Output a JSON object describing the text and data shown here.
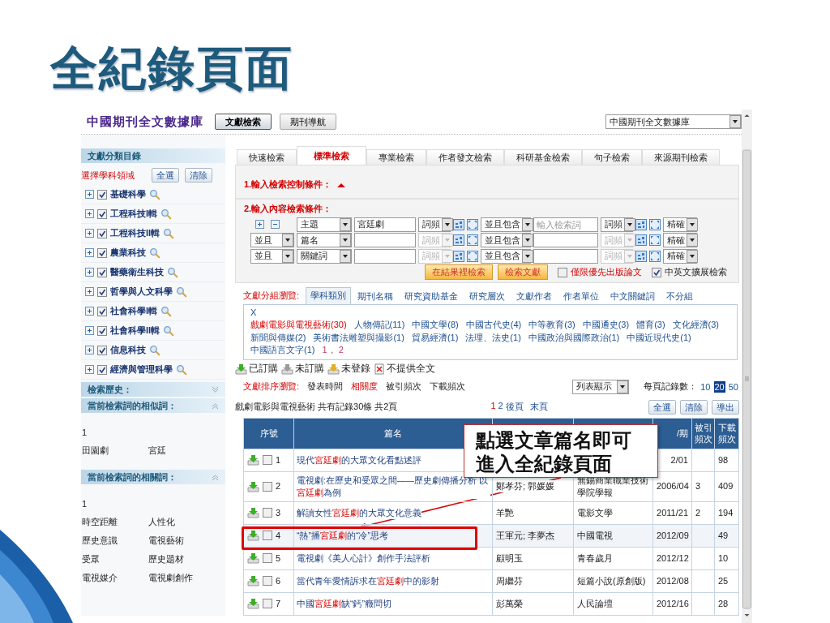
{
  "slide_title": "全紀錄頁面",
  "header": {
    "logo": "中國期刊全文數據庫",
    "tabs": [
      {
        "label": "文獻檢索",
        "selected": true
      },
      {
        "label": "期刊導航",
        "selected": false
      }
    ],
    "database_select": "中國期刊全文數據庫"
  },
  "sidebar": {
    "title": "文獻分類目錄",
    "subject_label": "選擇學科領域",
    "buttons": [
      "全選",
      "清除"
    ],
    "categories": [
      {
        "label": "基礎科學",
        "checked": true
      },
      {
        "label": "工程科技I輯",
        "checked": true
      },
      {
        "label": "工程科技II輯",
        "checked": true
      },
      {
        "label": "農業科技",
        "checked": true
      },
      {
        "label": "醫藥衛生科技",
        "checked": true
      },
      {
        "label": "哲學與人文科學",
        "checked": true
      },
      {
        "label": "社會科學I輯",
        "checked": true
      },
      {
        "label": "社會科學II輯",
        "checked": true
      },
      {
        "label": "信息科技",
        "checked": true
      },
      {
        "label": "經濟與管理科學",
        "checked": true
      }
    ],
    "history_title": "檢索歷史：",
    "similar_title": "當前檢索詞的相似詞：",
    "similar_page": "1",
    "similar_terms": [
      "田園劇",
      "宮廷"
    ],
    "related_title": "當前檢索詞的相關詞：",
    "related_page": "1",
    "related_terms": [
      "時空距離",
      "人性化",
      "歷史意識",
      "電視藝術",
      "受眾",
      "歷史題材",
      "電視媒介",
      "電視劇創作"
    ]
  },
  "search": {
    "tabs": [
      {
        "label": "快速檢索",
        "selected": false
      },
      {
        "label": "標準檢索",
        "selected": true
      },
      {
        "label": "專業檢索",
        "selected": false
      },
      {
        "label": "作者發文檢索",
        "selected": false
      },
      {
        "label": "科研基金檢索",
        "selected": false
      },
      {
        "label": "句子檢索",
        "selected": false
      },
      {
        "label": "來源期刊檢索",
        "selected": false
      }
    ],
    "control_title": "1.輸入檢索控制條件：",
    "content_title": "2.輸入內容檢索條件：",
    "rows": [
      {
        "kind": "first",
        "field": "主題",
        "term": {
          "value": "宮廷劇"
        },
        "freq": {
          "label": "詞頻",
          "disabled": false
        },
        "relation": "並且包含",
        "term2": {
          "placeholder": "輸入檢索詞"
        },
        "freq2": {
          "label": "詞頻",
          "disabled": false
        },
        "match": "精確"
      },
      {
        "kind": "extra",
        "logic": "並且",
        "field": "篇名",
        "freq": {
          "label": "詞頻",
          "disabled": true
        },
        "relation": "並且包含",
        "freq2": {
          "label": "詞頻",
          "disabled": true
        },
        "match": "精確"
      },
      {
        "kind": "extra",
        "logic": "並且",
        "field": "關鍵詞",
        "freq": {
          "label": "詞頻",
          "disabled": true
        },
        "relation": "並且包含",
        "freq2": {
          "label": "詞頻",
          "disabled": true
        },
        "match": "精確"
      }
    ],
    "buttons": [
      "在結果裡檢索",
      "檢索文獻"
    ],
    "options": [
      {
        "label": "僅限優先出版論文",
        "checked": false,
        "emphasis": true
      },
      {
        "label": "中英文擴展檢索",
        "checked": true,
        "emphasis": false
      }
    ]
  },
  "groups": {
    "label": "文獻分組瀏覽:",
    "tabs": [
      {
        "label": "學科類別",
        "selected": true
      },
      {
        "label": "期刊名稱",
        "selected": false
      },
      {
        "label": "研究資助基金",
        "selected": false
      },
      {
        "label": "研究層次",
        "selected": false
      },
      {
        "label": "文獻作者",
        "selected": false
      },
      {
        "label": "作者單位",
        "selected": false
      },
      {
        "label": "中文關鍵詞",
        "selected": false
      },
      {
        "label": "不分組",
        "selected": false
      }
    ],
    "clear": "X",
    "items": [
      {
        "label": "戲劇電影與電視藝術(30)",
        "selected": true
      },
      {
        "label": "人物傳記(11)",
        "selected": false
      },
      {
        "label": "中國文學(8)",
        "selected": false
      },
      {
        "label": "中國古代史(4)",
        "selected": false
      },
      {
        "label": "中等教育(3)",
        "selected": false
      },
      {
        "label": "中國通史(3)",
        "selected": false
      },
      {
        "label": "體育(3)",
        "selected": false
      },
      {
        "label": "文化經濟(3)",
        "selected": false
      },
      {
        "label": "新聞與傳媒(2)",
        "selected": false
      },
      {
        "label": "美術書法雕塑與攝影(1)",
        "selected": false
      },
      {
        "label": "貿易經濟(1)",
        "selected": false
      },
      {
        "label": "法理、法史(1)",
        "selected": false
      },
      {
        "label": "中國政治與國際政治(1)",
        "selected": false
      },
      {
        "label": "中國近現代史(1)",
        "selected": false
      },
      {
        "label": "中國語言文字(1)",
        "selected": false
      }
    ],
    "pages": "1， 2"
  },
  "legend": [
    {
      "kind": "bought",
      "label": "已訂購"
    },
    {
      "kind": "unsubscribed",
      "label": "未訂購"
    },
    {
      "kind": "not_logged_in",
      "label": "未登錄"
    },
    {
      "kind": "no_fulltext",
      "label": "不提供全文"
    }
  ],
  "sort": {
    "label": "文獻排序瀏覽:",
    "options": [
      {
        "label": "發表時間",
        "selected": false
      },
      {
        "label": "相關度",
        "selected": true
      },
      {
        "label": "被引頻次",
        "selected": false
      },
      {
        "label": "下載頻次",
        "selected": false
      }
    ],
    "view_select": "列表顯示",
    "page_size_label": "每頁記錄數：",
    "page_sizes": [
      {
        "label": "10",
        "selected": false
      },
      {
        "label": "20",
        "selected": true
      },
      {
        "label": "50",
        "selected": false
      }
    ]
  },
  "summary": {
    "text": "戲劇電影與電視藝術 共有記錄30條 共2頁",
    "pages": [
      {
        "label": "1",
        "selected": true
      },
      {
        "label": "2",
        "selected": false
      }
    ],
    "next": "後頁",
    "last": "末頁",
    "buttons": [
      "全選",
      "清除",
      "導出"
    ]
  },
  "table": {
    "headers": {
      "seq": "序號",
      "title": "篇名",
      "date": "/期",
      "cited": "被引頻次",
      "downloads": "下載頻次"
    },
    "rows": [
      {
        "seq": "1",
        "checked": false,
        "highlighted": false,
        "title": [
          {
            "text": "現代"
          },
          {
            "text": "宮廷劇",
            "hit": true
          },
          {
            "text": "的大眾文化看點述評"
          }
        ],
        "date": "2/01",
        "downloads": "98"
      },
      {
        "seq": "2",
        "checked": false,
        "highlighted": false,
        "title": [
          {
            "text": "電視劇:在歷史和受眾之間——歷史劇傳播分析 以"
          },
          {
            "text": "宮廷劇",
            "hit": true
          },
          {
            "text": "為例"
          }
        ],
        "author": "鄭孝芬; 郭媛媛",
        "source": "無錫商業職業技術學院學報",
        "date": "2006/04",
        "cited": "3",
        "downloads": "409"
      },
      {
        "seq": "3",
        "checked": false,
        "highlighted": false,
        "title": [
          {
            "text": "解讀女性"
          },
          {
            "text": "宮廷劇",
            "hit": true
          },
          {
            "text": "的大眾文化意義"
          }
        ],
        "author": "羊艷",
        "source": "電影文學",
        "date": "2011/21",
        "cited": "2",
        "downloads": "194"
      },
      {
        "seq": "4",
        "checked": false,
        "highlighted": true,
        "title": [
          {
            "text": "“熱”播"
          },
          {
            "text": "宮廷劇",
            "hit": true
          },
          {
            "text": "的“冷”思考"
          }
        ],
        "author": "王軍元; 李夢杰",
        "source": "中國電視",
        "date": "2012/09",
        "downloads": "49"
      },
      {
        "seq": "5",
        "checked": false,
        "highlighted": false,
        "title": [
          {
            "text": "電視劇《美人心計》創作手法評析"
          }
        ],
        "author": "顧明玉",
        "source": "青春歲月",
        "date": "2012/12",
        "downloads": "10"
      },
      {
        "seq": "6",
        "checked": false,
        "highlighted": false,
        "title": [
          {
            "text": "當代青年愛情訴求在"
          },
          {
            "text": "宮廷劇",
            "hit": true
          },
          {
            "text": "中的影射"
          }
        ],
        "author": "周繼芬",
        "source": "短篇小說(原創版)",
        "date": "2012/08",
        "downloads": "25"
      },
      {
        "seq": "7",
        "checked": false,
        "highlighted": false,
        "title": [
          {
            "text": "中國"
          },
          {
            "text": "宮廷劇",
            "hit": true
          },
          {
            "text": "缺“鈣”癥問切"
          }
        ],
        "author": "彭萬榮",
        "source": "人民論壇",
        "date": "2012/16",
        "downloads": "28"
      }
    ]
  },
  "callout": {
    "text": "點選文章篇名即可進入全紀錄頁面"
  }
}
